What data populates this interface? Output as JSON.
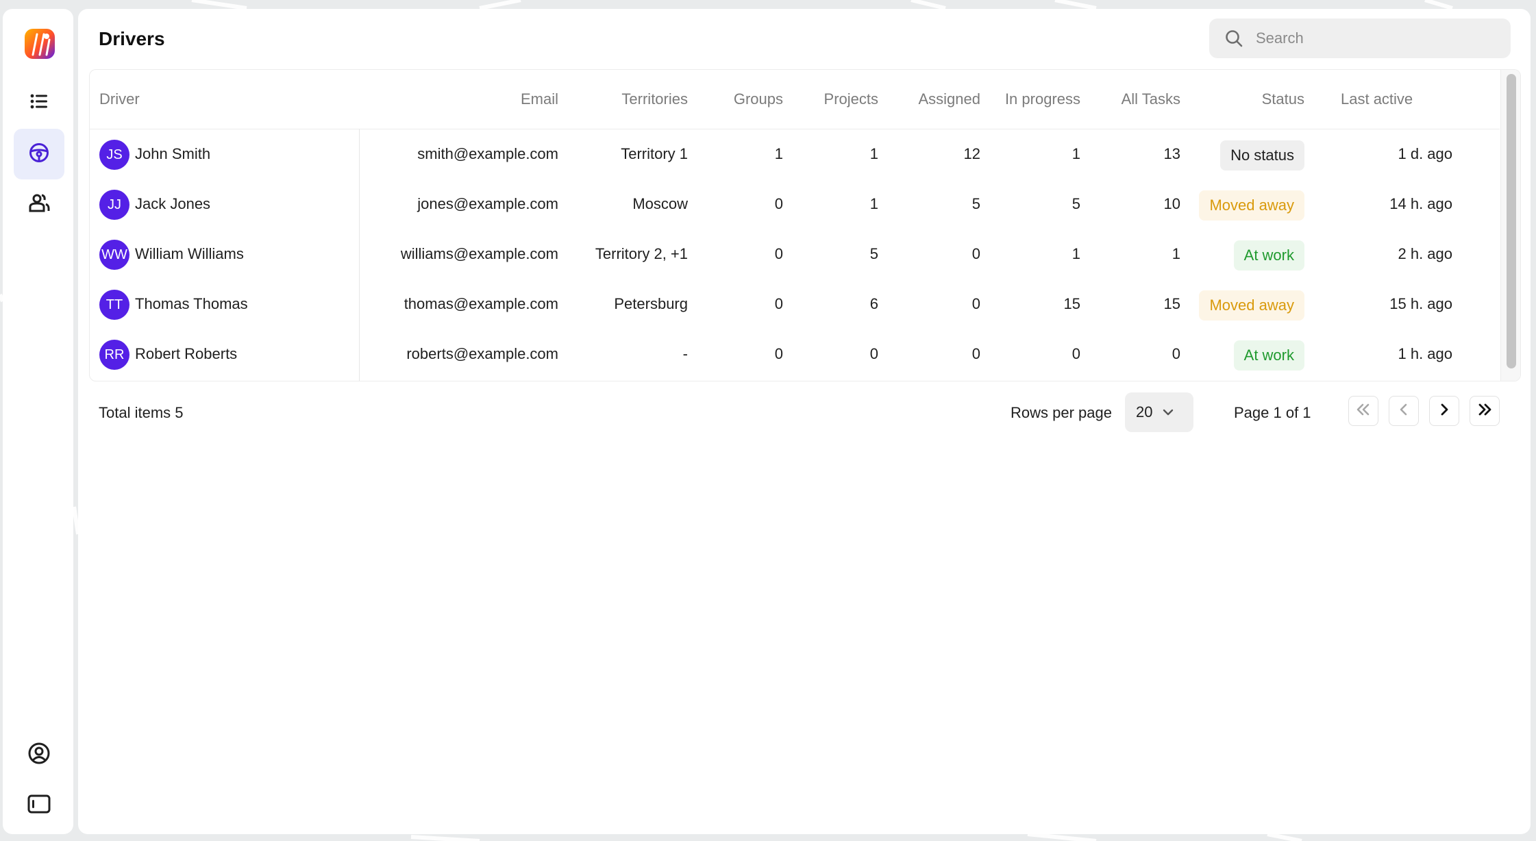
{
  "app": {
    "title": "Drivers"
  },
  "sidebar": {
    "items": [
      {
        "name": "list",
        "icon": "list-icon"
      },
      {
        "name": "drivers",
        "icon": "steering-wheel-icon",
        "active": true
      },
      {
        "name": "groups",
        "icon": "users-icon"
      }
    ],
    "bottom": [
      {
        "name": "profile",
        "icon": "user-circle-icon"
      },
      {
        "name": "panel",
        "icon": "sidebar-toggle-icon"
      }
    ]
  },
  "search": {
    "placeholder": "Search",
    "value": ""
  },
  "table": {
    "headers": {
      "driver": "Driver",
      "email": "Email",
      "territories": "Territories",
      "groups": "Groups",
      "projects": "Projects",
      "assigned": "Assigned",
      "in_progress": "In progress",
      "all_tasks": "All Tasks",
      "status": "Status",
      "last_active": "Last active"
    },
    "rows": [
      {
        "initials": "JS",
        "name": "John Smith",
        "email": "smith@example.com",
        "territories": "Territory 1",
        "groups": "1",
        "projects": "1",
        "assigned": "12",
        "in_progress": "1",
        "all_tasks": "13",
        "status": "No status",
        "last_active": "1 d. ago"
      },
      {
        "initials": "JJ",
        "name": "Jack Jones",
        "email": "jones@example.com",
        "territories": "Moscow",
        "groups": "0",
        "projects": "1",
        "assigned": "5",
        "in_progress": "5",
        "all_tasks": "10",
        "status": "Moved away",
        "last_active": "14 h. ago"
      },
      {
        "initials": "WW",
        "name": "William Williams",
        "email": "williams@example.com",
        "territories": "Territory 2, +1",
        "groups": "0",
        "projects": "5",
        "assigned": "0",
        "in_progress": "1",
        "all_tasks": "1",
        "status": "At work",
        "last_active": "2 h. ago"
      },
      {
        "initials": "TT",
        "name": "Thomas Thomas",
        "email": "thomas@example.com",
        "territories": "Petersburg",
        "groups": "0",
        "projects": "6",
        "assigned": "0",
        "in_progress": "15",
        "all_tasks": "15",
        "status": "Moved away",
        "last_active": "15 h. ago"
      },
      {
        "initials": "RR",
        "name": "Robert Roberts",
        "email": "roberts@example.com",
        "territories": "-",
        "groups": "0",
        "projects": "0",
        "assigned": "0",
        "in_progress": "0",
        "all_tasks": "0",
        "status": "At work",
        "last_active": "1 h. ago"
      }
    ]
  },
  "status_colors": {
    "No status": {
      "bg": "#efefef",
      "fg": "#1f1f1f"
    },
    "Moved away": {
      "bg": "#fdf5e6",
      "fg": "#d99a0c"
    },
    "At work": {
      "bg": "#ebf7ec",
      "fg": "#1f9a2e"
    }
  },
  "footer": {
    "total": "Total items 5",
    "rows_per_page_label": "Rows per page",
    "rows_per_page_value": "20",
    "page_info": "Page 1 of 1"
  },
  "colors": {
    "accent": "#5420e6"
  }
}
